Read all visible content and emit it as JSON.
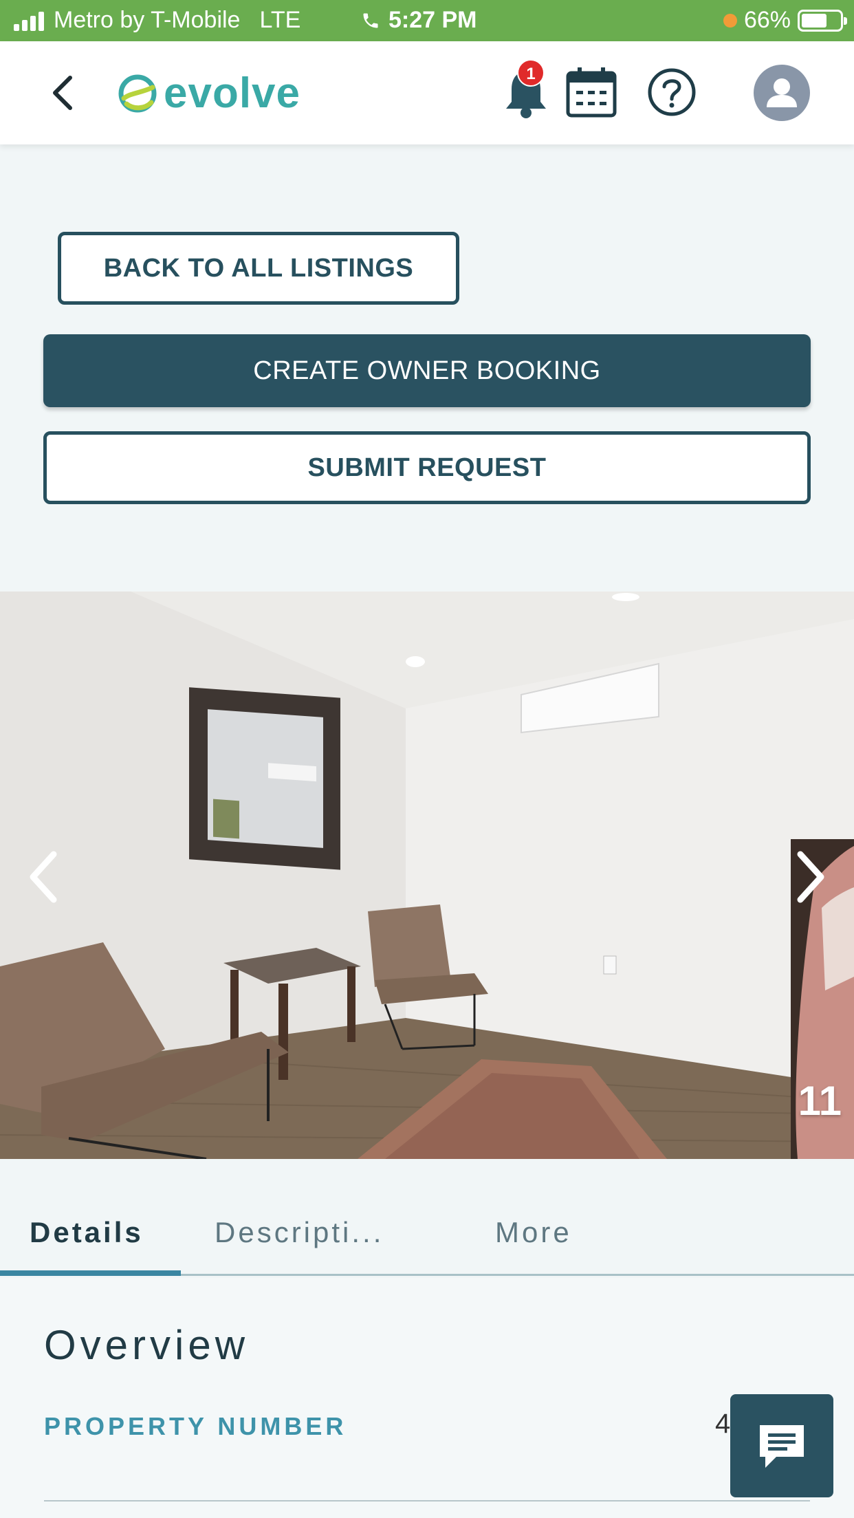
{
  "status_bar": {
    "carrier": "Metro by T-Mobile",
    "network": "LTE",
    "time": "5:27 PM",
    "battery": "66%",
    "battery_level": 0.66,
    "bar_color": "#6aad4f"
  },
  "header": {
    "logo_text": "evolve",
    "notification_count": "1",
    "brand_color": "#3aa9a6"
  },
  "actions": {
    "back_label": "BACK TO ALL LISTINGS",
    "create_label": "CREATE OWNER BOOKING",
    "submit_label": "SUBMIT REQUEST",
    "primary_color": "#2a5261"
  },
  "gallery": {
    "photo_index": "11"
  },
  "tabs": [
    {
      "label": "Details",
      "active": true
    },
    {
      "label": "Descripti...",
      "active": false
    },
    {
      "label": "More",
      "active": false
    }
  ],
  "overview": {
    "heading": "Overview",
    "property_number_label": "PROPERTY NUMBER",
    "property_number_value": "4"
  },
  "icons": {
    "back": "chevron-left-icon",
    "bell": "bell-icon",
    "calendar": "calendar-icon",
    "help": "help-icon",
    "avatar": "user-avatar-icon",
    "chat": "chat-icon"
  }
}
